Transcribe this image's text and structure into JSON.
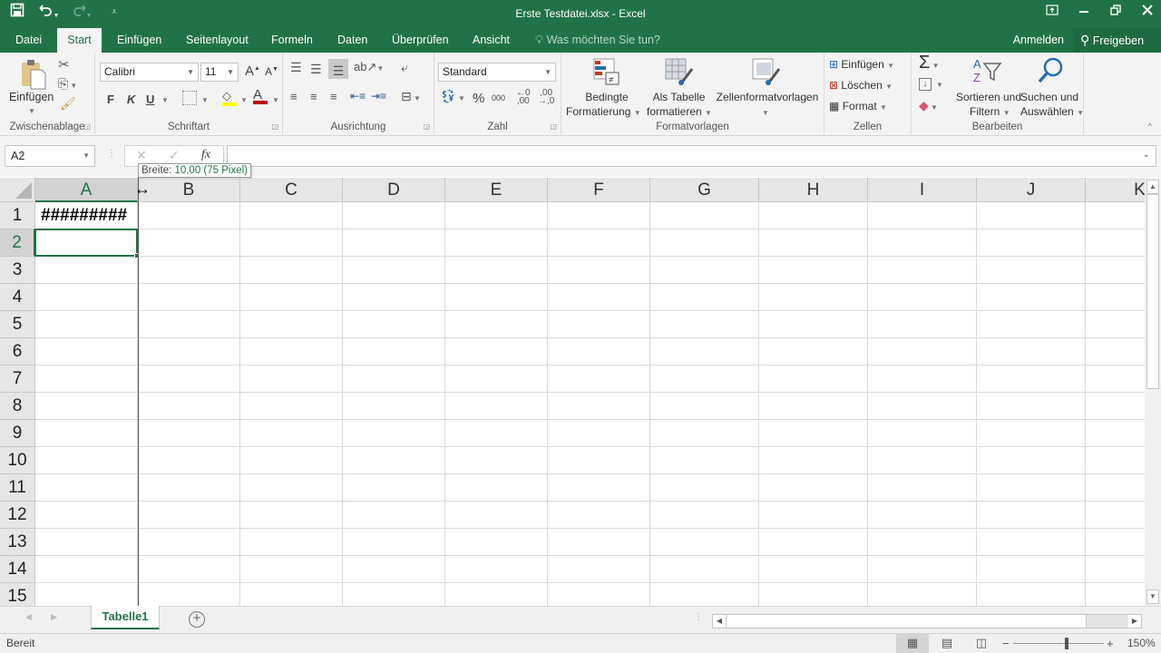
{
  "window": {
    "title": "Erste Testdatei.xlsx - Excel",
    "qat": {
      "save_icon": "save-icon",
      "undo_icon": "undo-icon",
      "redo_icon": "redo-icon",
      "customize_icon": "customize-qat-icon"
    },
    "controls": {
      "ribbon_display": "ribbon-display-options-icon",
      "minimize": "minimize-icon",
      "restore": "restore-icon",
      "close": "close-icon"
    }
  },
  "tabs": [
    {
      "label": "Datei",
      "active": false
    },
    {
      "label": "Start",
      "active": true
    },
    {
      "label": "Einfügen",
      "active": false
    },
    {
      "label": "Seitenlayout",
      "active": false
    },
    {
      "label": "Formeln",
      "active": false
    },
    {
      "label": "Daten",
      "active": false
    },
    {
      "label": "Überprüfen",
      "active": false
    },
    {
      "label": "Ansicht",
      "active": false
    }
  ],
  "tell_me": "Was möchten Sie tun?",
  "account": {
    "signin": "Anmelden",
    "share": "Freigeben"
  },
  "ribbon": {
    "clipboard": {
      "label": "Zwischenablage",
      "paste": "Einfügen"
    },
    "font": {
      "label": "Schriftart",
      "font_name": "Calibri",
      "font_size": "11",
      "bold": "F",
      "italic": "K",
      "underline": "U",
      "grow": "A",
      "shrink": "A",
      "font_color": "A",
      "fill_color": "#ffff00",
      "text_color": "#c00000"
    },
    "alignment": {
      "label": "Ausrichtung"
    },
    "number": {
      "label": "Zahl",
      "format": "Standard",
      "percent": "%",
      "thousands": "000"
    },
    "styles": {
      "label": "Formatvorlagen",
      "conditional_1": "Bedingte",
      "conditional_2": "Formatierung",
      "table_1": "Als Tabelle",
      "table_2": "formatieren",
      "cell_styles": "Zellenformatvorlagen"
    },
    "cells": {
      "label": "Zellen",
      "insert": "Einfügen",
      "delete": "Löschen",
      "format": "Format"
    },
    "editing": {
      "label": "Bearbeiten",
      "sort_1": "Sortieren und",
      "sort_2": "Filtern",
      "find_1": "Suchen und",
      "find_2": "Auswählen",
      "sum": "Σ"
    }
  },
  "formula_bar": {
    "name_box": "A2",
    "fx": "fx",
    "cancel": "✕",
    "enter": "✓",
    "value": ""
  },
  "tooltip": {
    "prefix": "Breite: ",
    "value": "10,00 (75 Pixel)"
  },
  "sheet": {
    "columns": [
      "A",
      "B",
      "C",
      "D",
      "E",
      "F",
      "G",
      "H",
      "I",
      "J",
      "K"
    ],
    "rows": [
      "1",
      "2",
      "3",
      "4",
      "5",
      "6",
      "7",
      "8",
      "9",
      "10",
      "11",
      "12",
      "13",
      "14",
      "15"
    ],
    "selected_cell": "A2",
    "cells": {
      "A1": "#########"
    }
  },
  "sheet_tabs": [
    {
      "label": "Tabelle1",
      "active": true
    }
  ],
  "status": {
    "text": "Bereit",
    "zoom": "150%",
    "zoom_level_percent": 150
  }
}
